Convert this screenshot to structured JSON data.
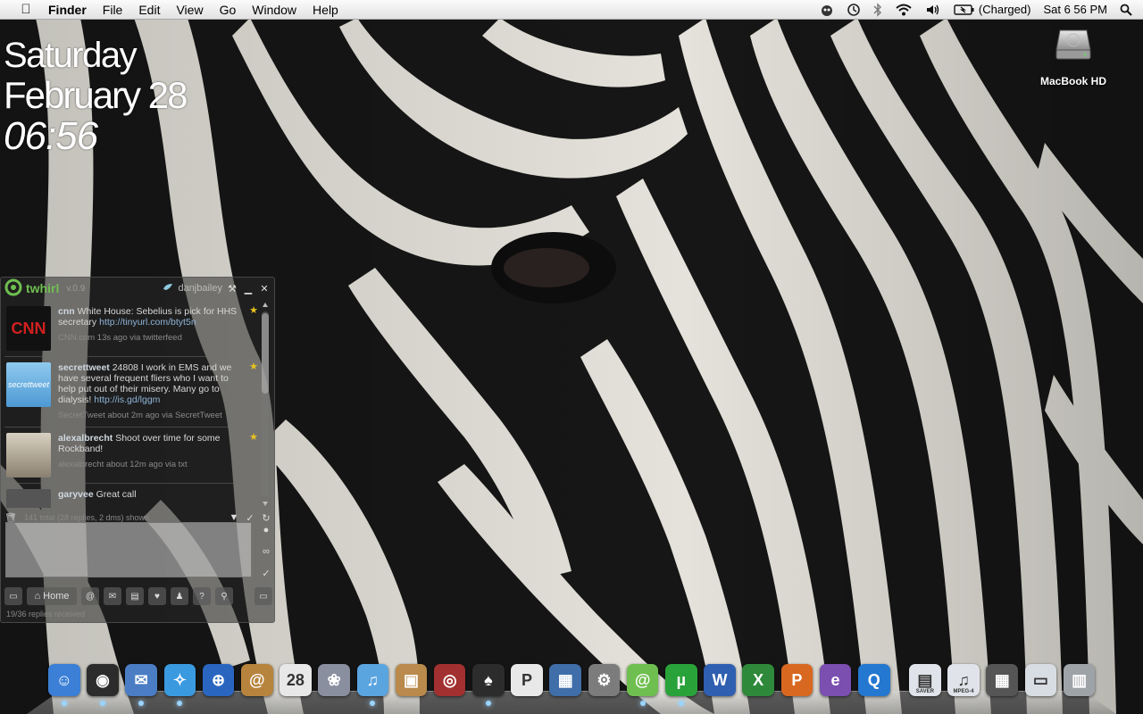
{
  "menubar": {
    "apple_icon": "apple-icon",
    "app_name": "Finder",
    "items": [
      "File",
      "Edit",
      "View",
      "Go",
      "Window",
      "Help"
    ],
    "status": {
      "battery_text": "(Charged)",
      "clock": "Sat 6 56 PM"
    }
  },
  "clock_widget": {
    "day": "Saturday",
    "date": "February 28",
    "time": "06:56"
  },
  "desktop_icons": [
    {
      "label": "MacBook HD",
      "icon": "hard-drive-icon"
    }
  ],
  "twhirl": {
    "app_name": "twhirl",
    "version": "v.0.9",
    "username": "danjbailey",
    "tweets": [
      {
        "avatar_text": "CNN",
        "author": "cnn",
        "text": "White House: Sebelius is pick for HHS secretary",
        "link": "http://tinyurl.com/btyt5n",
        "meta": "CNN.com 13s ago via twitterfeed"
      },
      {
        "avatar_text": "secrettweet",
        "author": "secrettweet",
        "text": "24808 I work in EMS and we have several frequent fliers who I want to help put out of their misery. Many go to dialysis!",
        "link": "http://is.gd/lggm",
        "meta": "SecretTweet about 2m ago via SecretTweet"
      },
      {
        "avatar_text": "",
        "author": "alexalbrecht",
        "text": "Shoot over time for some Rockband!",
        "link": "",
        "meta": "alexalbrecht about 12m ago via txt"
      },
      {
        "avatar_text": "",
        "author": "garyvee",
        "text": "Great call",
        "link": "",
        "meta": ""
      }
    ],
    "status_line": "141 total (28 replies, 2 dms) shown",
    "home_label": "Home",
    "footer": "19/36 replies received"
  },
  "dock": {
    "apps": [
      {
        "name": "finder-icon",
        "color": "#3b7fd6",
        "glyph": "☺"
      },
      {
        "name": "dashboard-icon",
        "color": "#2c2c2c",
        "glyph": "◉"
      },
      {
        "name": "mail-icon",
        "color": "#4a7dc4",
        "glyph": "✉"
      },
      {
        "name": "safari-icon",
        "color": "#3a9ae0",
        "glyph": "✧"
      },
      {
        "name": "network-icon",
        "color": "#2a66c0",
        "glyph": "⊕"
      },
      {
        "name": "address-book-icon",
        "color": "#b7843e",
        "glyph": "@"
      },
      {
        "name": "ical-icon",
        "color": "#e8e8e8",
        "glyph": "28"
      },
      {
        "name": "iphoto-icon",
        "color": "#8a8fa0",
        "glyph": "❀"
      },
      {
        "name": "itunes-icon",
        "color": "#5aa4e0",
        "glyph": "♫"
      },
      {
        "name": "preview-icon",
        "color": "#b98a4c",
        "glyph": "▣"
      },
      {
        "name": "photo-booth-icon",
        "color": "#a23030",
        "glyph": "◎"
      },
      {
        "name": "adium-icon",
        "color": "#2c2c2c",
        "glyph": "♠"
      },
      {
        "name": "pandora-icon",
        "color": "#e8e8e8",
        "glyph": "P"
      },
      {
        "name": "spaces-icon",
        "color": "#3f6ea8",
        "glyph": "▦"
      },
      {
        "name": "system-preferences-icon",
        "color": "#7c7c7c",
        "glyph": "⚙"
      },
      {
        "name": "twhirl-icon",
        "color": "#6fbf50",
        "glyph": "@"
      },
      {
        "name": "utorrent-icon",
        "color": "#2aa23a",
        "glyph": "µ"
      },
      {
        "name": "word-icon",
        "color": "#2e5fb0",
        "glyph": "W"
      },
      {
        "name": "excel-icon",
        "color": "#2e8a3a",
        "glyph": "X"
      },
      {
        "name": "powerpoint-icon",
        "color": "#d86820",
        "glyph": "P"
      },
      {
        "name": "entourage-icon",
        "color": "#7a4fb0",
        "glyph": "e"
      },
      {
        "name": "quicktime-icon",
        "color": "#2478d0",
        "glyph": "Q"
      }
    ],
    "docs": [
      {
        "name": "saver-document-icon",
        "color": "#e0e4ea",
        "glyph": "▤",
        "label": "SAVER"
      },
      {
        "name": "mpeg4-document-icon",
        "color": "#e0e4ea",
        "glyph": "♫",
        "label": "MPEG-4"
      },
      {
        "name": "pictures-stack-icon",
        "color": "#555",
        "glyph": "▦",
        "label": ""
      },
      {
        "name": "downloads-stack-icon",
        "color": "#d8dde4",
        "glyph": "▭",
        "label": ""
      },
      {
        "name": "trash-icon",
        "color": "#9ea3a8",
        "glyph": "▥",
        "label": ""
      }
    ]
  }
}
